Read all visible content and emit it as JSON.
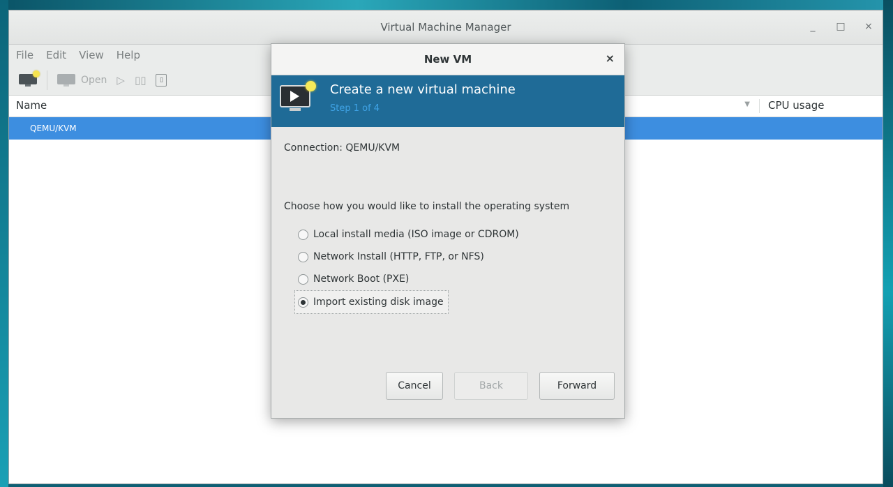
{
  "main_window": {
    "title": "Virtual Machine Manager",
    "controls": {
      "minimize": "_",
      "maximize": "□",
      "close": "×"
    },
    "menu": [
      "File",
      "Edit",
      "View",
      "Help"
    ],
    "toolbar": {
      "open_label": "Open"
    },
    "list": {
      "columns": {
        "name": "Name",
        "cpu": "CPU usage"
      },
      "rows": [
        "QEMU/KVM"
      ]
    }
  },
  "dialog": {
    "title": "New VM",
    "close": "×",
    "banner": {
      "title": "Create a new virtual machine",
      "step": "Step 1 of 4"
    },
    "connection": "Connection:  QEMU/KVM",
    "prompt": "Choose how you would like to install the operating system",
    "options": [
      {
        "label": "Local install media (ISO image or CDROM)",
        "selected": false
      },
      {
        "label": "Network Install (HTTP, FTP, or NFS)",
        "selected": false
      },
      {
        "label": "Network Boot (PXE)",
        "selected": false
      },
      {
        "label": "Import existing disk image",
        "selected": true
      }
    ],
    "buttons": {
      "cancel": "Cancel",
      "back": "Back",
      "forward": "Forward"
    }
  },
  "colors": {
    "accent": "#3d8ee0",
    "banner": "#1f6b97",
    "step_text": "#3fa3e6"
  }
}
